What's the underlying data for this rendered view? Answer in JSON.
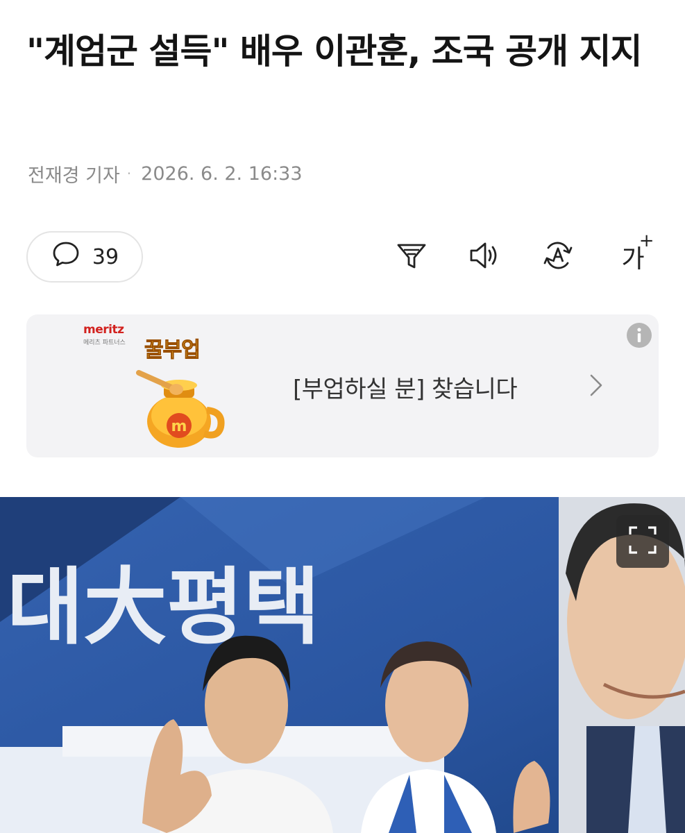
{
  "article": {
    "headline": "\"계엄군 설득\" 배우 이관훈, 조국 공개 지지",
    "reporter": "전재경 기자",
    "byline_separator": "·",
    "timestamp": "2026. 6. 2. 16:33"
  },
  "toolbar": {
    "comment_count": "39",
    "font_size_label": "가",
    "font_size_plus": "+",
    "icons": [
      "comment-icon",
      "summary-filter-icon",
      "speaker-icon",
      "translate-icon",
      "font-size-icon"
    ]
  },
  "ad": {
    "brand": "meritz",
    "brand_sub": "메리츠 파트너스",
    "badge": "꿀부업",
    "message": "[부업하실 분] 찾습니다",
    "icons": [
      "info-icon",
      "chevron-right-icon"
    ]
  },
  "photo": {
    "banner_text": "대大평택",
    "icons": [
      "expand-icon"
    ]
  },
  "colors": {
    "brand_red": "#d2221f",
    "banner_blue": "#2f5fae",
    "muted_text": "#8a8a8a"
  }
}
